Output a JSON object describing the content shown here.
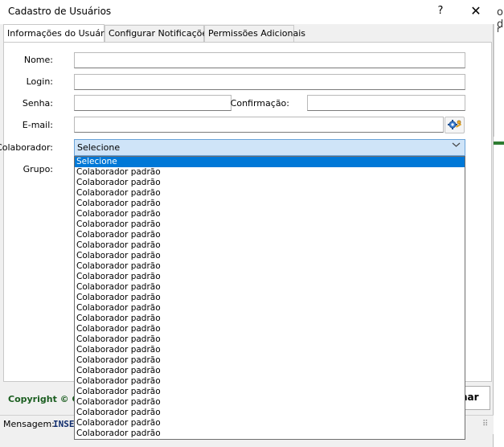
{
  "window": {
    "title": "Cadastro de Usuários",
    "help_glyph": "?",
    "close_glyph": "✕"
  },
  "background": {
    "partial_text_top": "o d",
    "partial_text_small": "r"
  },
  "tabs": [
    {
      "label": "Informações do Usuário",
      "active": true
    },
    {
      "label": "Configurar Notificações",
      "active": false
    },
    {
      "label": "Permissões Adicionais",
      "active": false
    }
  ],
  "form": {
    "nome_label": "Nome:",
    "nome_value": "",
    "login_label": "Login:",
    "login_value": "",
    "senha_label": "Senha:",
    "senha_value": "",
    "confirmacao_label": "Confirmação:",
    "confirmacao_value": "",
    "email_label": "E-mail:",
    "email_value": "",
    "colaborador_label": "Colaborador:",
    "colaborador_value": "Selecione",
    "grupo_label": "Grupo:"
  },
  "dropdown": {
    "items": [
      "Selecione",
      "Colaborador padrão",
      "Colaborador padrão",
      "Colaborador padrão",
      "Colaborador padrão",
      "Colaborador padrão",
      "Colaborador padrão",
      "Colaborador padrão",
      "Colaborador padrão",
      "Colaborador padrão",
      "Colaborador padrão",
      "Colaborador padrão",
      "Colaborador padrão",
      "Colaborador padrão",
      "Colaborador padrão",
      "Colaborador padrão",
      "Colaborador padrão",
      "Colaborador padrão",
      "Colaborador padrão",
      "Colaborador padrão",
      "Colaborador padrão",
      "Colaborador padrão",
      "Colaborador padrão",
      "Colaborador padrão",
      "Colaborador padrão",
      "Colaborador padrão",
      "Colaborador padrão"
    ],
    "selected_index": 0
  },
  "footer": {
    "copyright": "Copyright © Co",
    "button_label": "har",
    "status_label": "Mensagem:",
    "status_message": "INSE"
  },
  "icons": {
    "key_settings": "key-gear-icon",
    "combo_arrow": "chevron-down-icon",
    "resize_grip": "resize-grip-icon"
  },
  "colors": {
    "selection": "#0078d7",
    "combo_focus": "#cfe4f8",
    "copyright_green": "#1b5e20",
    "status_blue": "#0d2a6b"
  }
}
